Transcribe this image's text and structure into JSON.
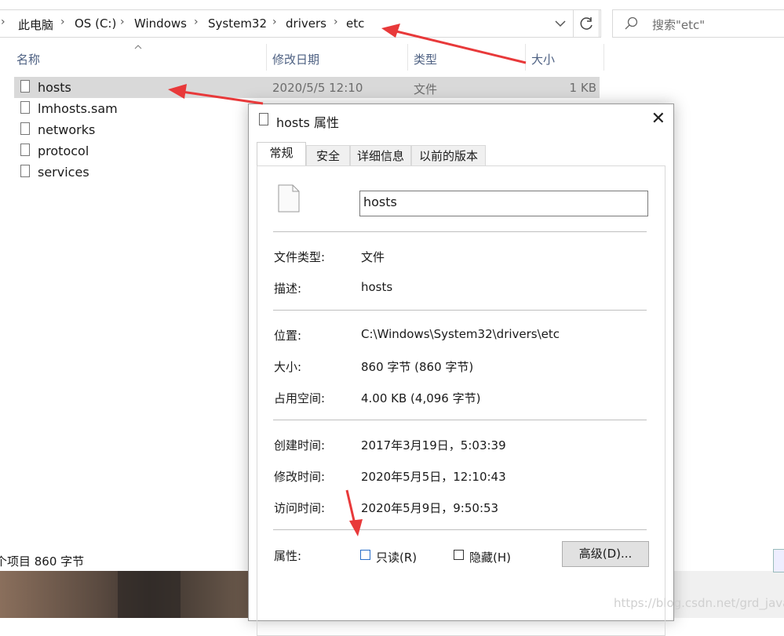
{
  "address_bar": {
    "crumbs": [
      "此电脑",
      "OS (C:)",
      "Windows",
      "System32",
      "drivers",
      "etc"
    ],
    "search_placeholder": "搜索\"etc\""
  },
  "columns": {
    "name": "名称",
    "date": "修改日期",
    "type": "类型",
    "size": "大小"
  },
  "files": [
    {
      "name": "hosts",
      "date": "2020/5/5 12:10",
      "type": "文件",
      "size": "1 KB",
      "selected": true
    },
    {
      "name": "lmhosts.sam"
    },
    {
      "name": "networks"
    },
    {
      "name": "protocol"
    },
    {
      "name": "services"
    }
  ],
  "status_bar": {
    "text": "个项目  860 字节"
  },
  "dialog": {
    "title": "hosts 属性",
    "tabs": [
      "常规",
      "安全",
      "详细信息",
      "以前的版本"
    ],
    "active_tab": "常规",
    "file_name": "hosts",
    "props": {
      "type_label": "文件类型:",
      "type_value": "文件",
      "desc_label": "描述:",
      "desc_value": "hosts",
      "loc_label": "位置:",
      "loc_value": "C:\\Windows\\System32\\drivers\\etc",
      "size_label": "大小:",
      "size_value": "860 字节 (860 字节)",
      "disk_label": "占用空间:",
      "disk_value": "4.00 KB (4,096 字节)",
      "created_label": "创建时间:",
      "created_value": "2017年3月19日，5:03:39",
      "modified_label": "修改时间:",
      "modified_value": "2020年5月5日，12:10:43",
      "accessed_label": "访问时间:",
      "accessed_value": "2020年5月9日，9:50:53",
      "attr_label": "属性:"
    },
    "readonly_label": "只读(R)",
    "readonly_checked": false,
    "hidden_label": "隐藏(H)",
    "hidden_checked": false,
    "advanced_button": "高级(D)..."
  },
  "watermark": "https://blog.csdn.net/grd_java",
  "colors": {
    "accent": "#2a6fc9",
    "arrow": "#e8393a",
    "selected_row": "#d9d9d9"
  }
}
